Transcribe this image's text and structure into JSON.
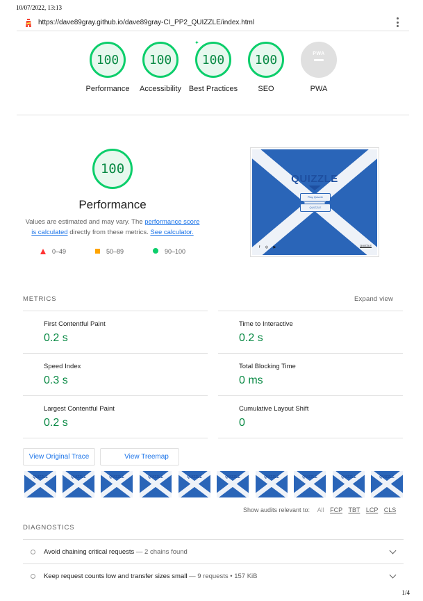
{
  "print": {
    "timestamp": "10/07/2022, 13:13",
    "page": "1/4"
  },
  "topbar": {
    "url": "https://dave89gray.github.io/dave89gray-CI_PP2_QUIZZLE/index.html"
  },
  "scores": [
    {
      "label": "Performance",
      "value": "100"
    },
    {
      "label": "Accessibility",
      "value": "100"
    },
    {
      "label": "Best Practices",
      "value": "100"
    },
    {
      "label": "SEO",
      "value": "100"
    },
    {
      "label": "PWA",
      "value": "PWA"
    }
  ],
  "performance": {
    "score": "100",
    "title": "Performance",
    "desc_pre": "Values are estimated and may vary. The ",
    "link1": "performance score is calculated",
    "desc_mid": " directly from these metrics. ",
    "link2": "See calculator.",
    "scale": {
      "fail": "0–49",
      "average": "50–89",
      "pass": "90–100"
    }
  },
  "screenshot": {
    "title": "QUIZZLE",
    "btn1": "Play Quizzle",
    "btn2": "QUIZZLE",
    "social": "f ◎ ▶",
    "right_text": "QUIZZLE"
  },
  "metrics": {
    "heading": "METRICS",
    "expand": "Expand view",
    "items": [
      {
        "label": "First Contentful Paint",
        "value": "0.2 s"
      },
      {
        "label": "Time to Interactive",
        "value": "0.2 s"
      },
      {
        "label": "Speed Index",
        "value": "0.3 s"
      },
      {
        "label": "Total Blocking Time",
        "value": "0 ms"
      },
      {
        "label": "Largest Contentful Paint",
        "value": "0.2 s"
      },
      {
        "label": "Cumulative Layout Shift",
        "value": "0"
      }
    ]
  },
  "buttons": {
    "trace": "View Original Trace",
    "treemap": "View Treemap"
  },
  "filmstrip": {
    "frame_title": "QUIZZLE"
  },
  "filters": {
    "label": "Show audits relevant to:",
    "items": [
      "All",
      "FCP",
      "TBT",
      "LCP",
      "CLS"
    ]
  },
  "diagnostics": {
    "heading": "DIAGNOSTICS",
    "items": [
      {
        "title": "Avoid chaining critical requests",
        "sep": " — ",
        "detail": "2 chains found"
      },
      {
        "title": "Keep request counts low and transfer sizes small",
        "sep": " — ",
        "detail": "9 requests • 157 KiB"
      }
    ]
  },
  "colors": {
    "pass": "#0cce6b",
    "pass_text": "#0a8a45",
    "link": "#1a73e8",
    "fail": "#ff3333",
    "average": "#ffa400",
    "flag_blue": "#2a65b8"
  }
}
